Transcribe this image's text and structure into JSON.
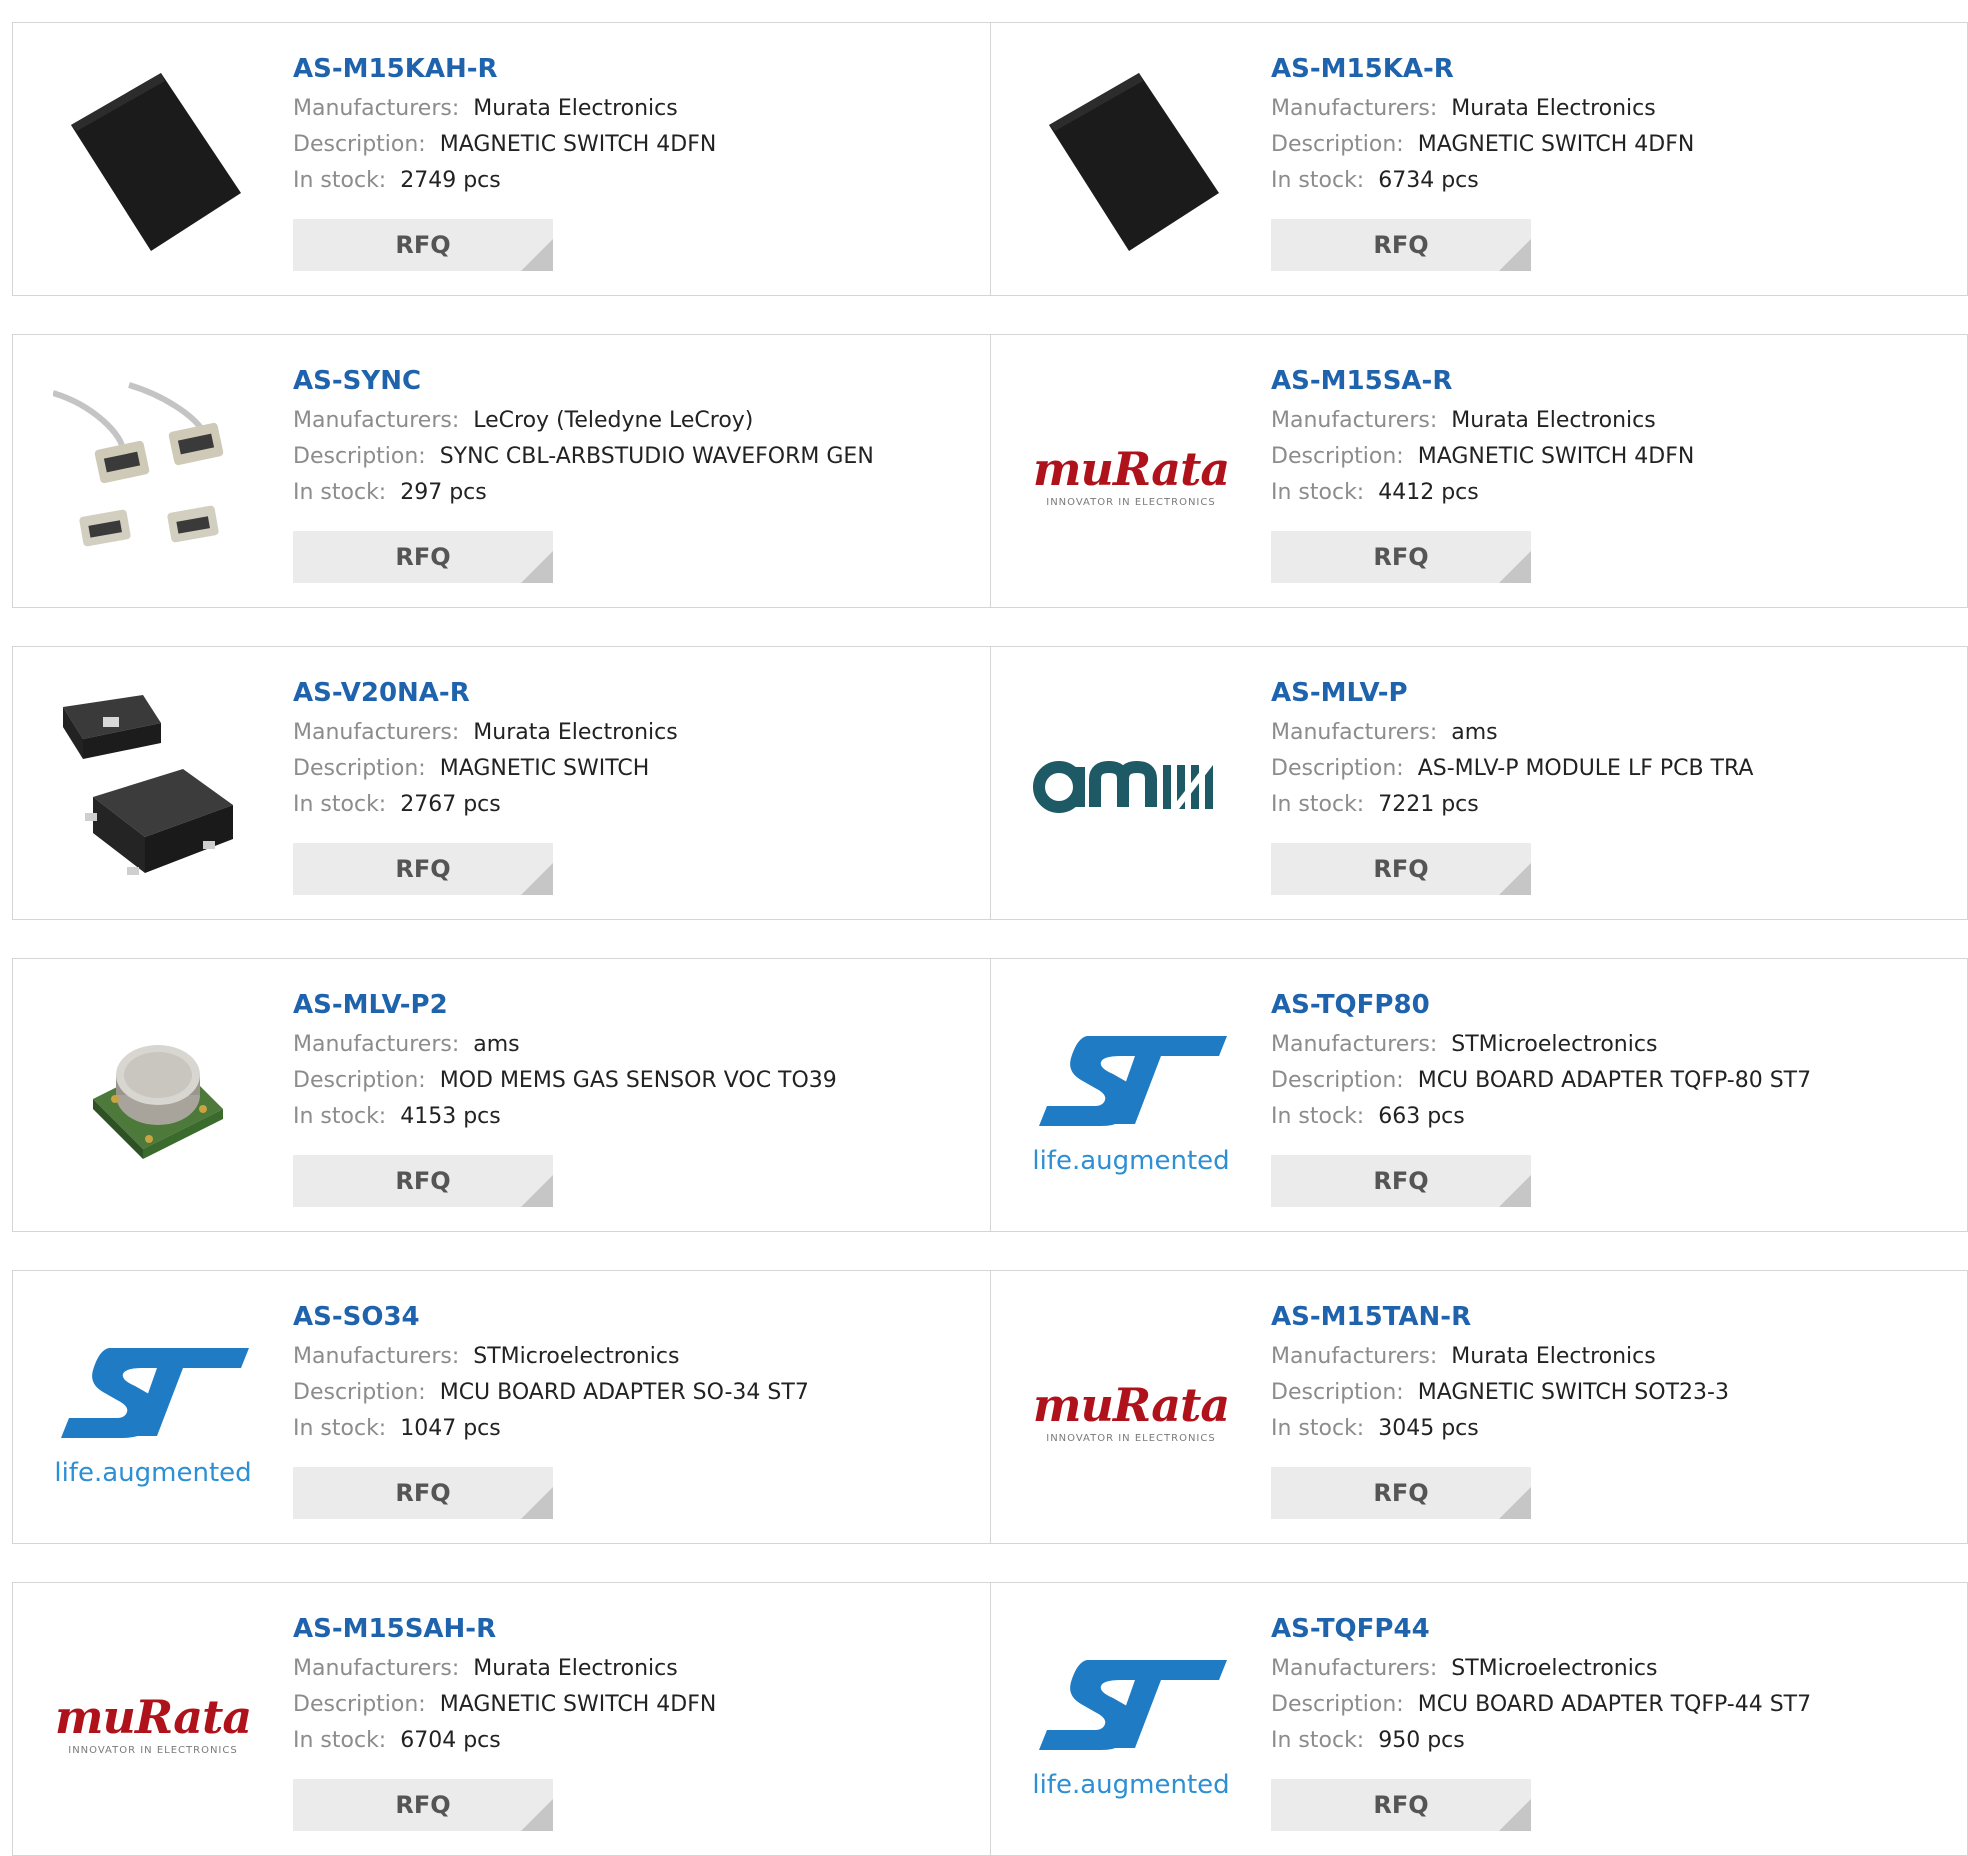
{
  "labels": {
    "manufacturers": "Manufacturers:",
    "description": "Description:",
    "in_stock": "In stock:",
    "rfq": "RFQ"
  },
  "colors": {
    "link": "#1f63ad",
    "label": "#8c8c8c",
    "button_bg": "#ebebeb",
    "border": "#d5d5d5"
  },
  "rows": [
    {
      "left": {
        "part": "AS-M15KAH-R",
        "manufacturer": "Murata Electronics",
        "description": "MAGNETIC SWITCH 4DFN",
        "stock": "2749 pcs",
        "thumb": "black-dfn-chip"
      },
      "right": {
        "part": "AS-M15KA-R",
        "manufacturer": "Murata Electronics",
        "description": "MAGNETIC SWITCH 4DFN",
        "stock": "6734 pcs",
        "thumb": "black-dfn-chip"
      }
    },
    {
      "left": {
        "part": "AS-SYNC",
        "manufacturer": "LeCroy (Teledyne LeCroy)",
        "description": "SYNC CBL-ARBSTUDIO WAVEFORM GEN",
        "stock": "297 pcs",
        "thumb": "sync-cable-connectors"
      },
      "right": {
        "part": "AS-M15SA-R",
        "manufacturer": "Murata Electronics",
        "description": "MAGNETIC SWITCH 4DFN",
        "stock": "4412 pcs",
        "thumb": "murata-logo"
      }
    },
    {
      "left": {
        "part": "AS-V20NA-R",
        "manufacturer": "Murata Electronics",
        "description": "MAGNETIC SWITCH",
        "stock": "2767 pcs",
        "thumb": "smd-magnetic-switch"
      },
      "right": {
        "part": "AS-MLV-P",
        "manufacturer": "ams",
        "description": "AS-MLV-P MODULE LF PCB TRA",
        "stock": "7221 pcs",
        "thumb": "ams-logo"
      }
    },
    {
      "left": {
        "part": "AS-MLV-P2",
        "manufacturer": "ams",
        "description": "MOD MEMS GAS SENSOR VOC TO39",
        "stock": "4153 pcs",
        "thumb": "gas-sensor-module"
      },
      "right": {
        "part": "AS-TQFP80",
        "manufacturer": "STMicroelectronics",
        "description": "MCU BOARD ADAPTER TQFP-80 ST7",
        "stock": "663 pcs",
        "thumb": "st-logo"
      }
    },
    {
      "left": {
        "part": "AS-SO34",
        "manufacturer": "STMicroelectronics",
        "description": "MCU BOARD ADAPTER SO-34 ST7",
        "stock": "1047 pcs",
        "thumb": "st-logo"
      },
      "right": {
        "part": "AS-M15TAN-R",
        "manufacturer": "Murata Electronics",
        "description": "MAGNETIC SWITCH SOT23-3",
        "stock": "3045 pcs",
        "thumb": "murata-logo"
      }
    },
    {
      "left": {
        "part": "AS-M15SAH-R",
        "manufacturer": "Murata Electronics",
        "description": "MAGNETIC SWITCH 4DFN",
        "stock": "6704 pcs",
        "thumb": "murata-logo"
      },
      "right": {
        "part": "AS-TQFP44",
        "manufacturer": "STMicroelectronics",
        "description": "MCU BOARD ADAPTER TQFP-44 ST7",
        "stock": "950 pcs",
        "thumb": "st-logo"
      }
    }
  ],
  "logos": {
    "murata_word": "muRata",
    "murata_tagline": "INNOVATOR IN ELECTRONICS",
    "st_tagline": "life.augmented"
  }
}
